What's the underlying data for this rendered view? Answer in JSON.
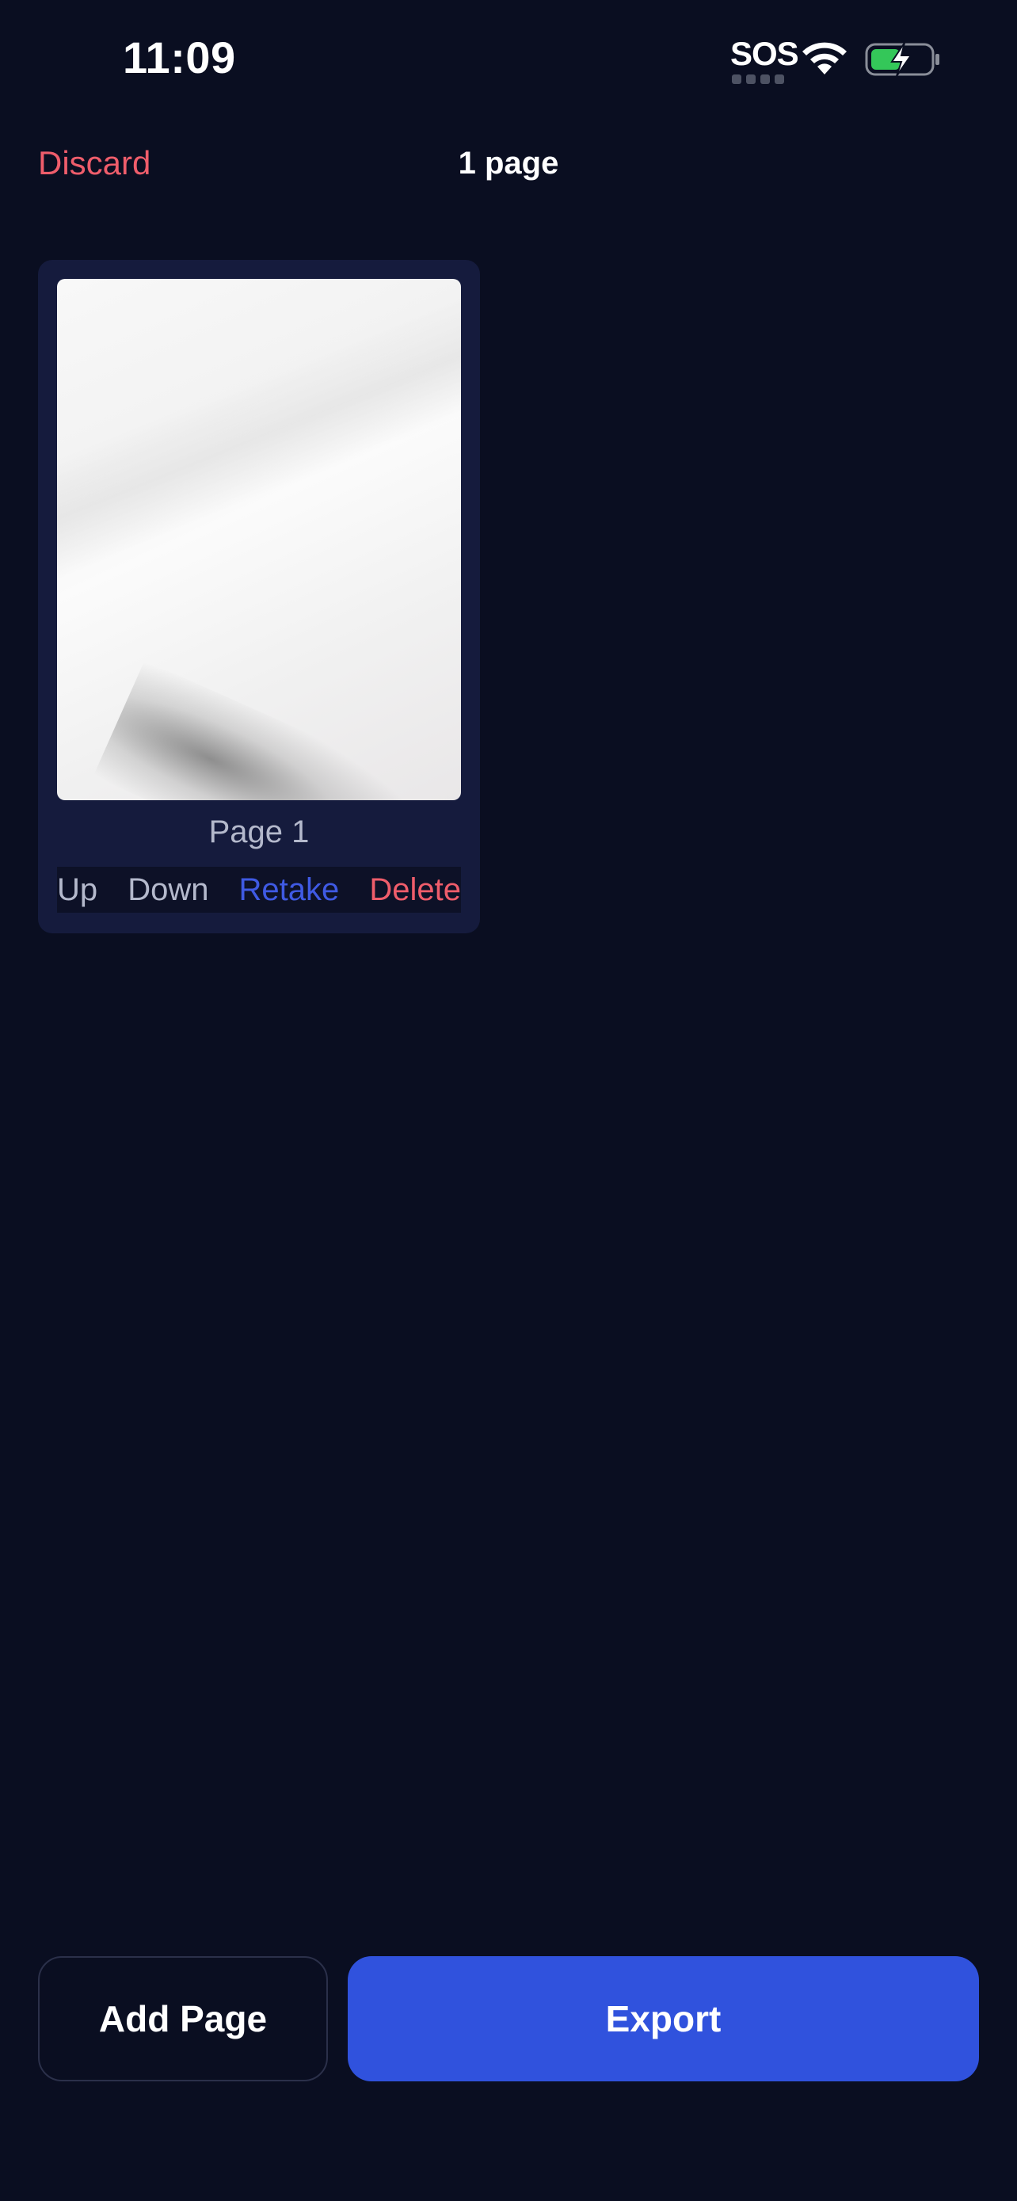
{
  "status_bar": {
    "time": "11:09",
    "sos": "SOS",
    "battery_color": "#34c759",
    "icons": [
      "wifi-icon",
      "battery-charging-icon"
    ]
  },
  "nav": {
    "discard_label": "Discard",
    "page_count": "1 page"
  },
  "pages": [
    {
      "label": "Page 1",
      "actions": {
        "up": "Up",
        "down": "Down",
        "retake": "Retake",
        "delete": "Delete"
      }
    }
  ],
  "footer": {
    "add_page_label": "Add Page",
    "export_label": "Export"
  },
  "colors": {
    "background": "#0a0e21",
    "card": "#151b3d",
    "accent_blue": "#3052dd",
    "danger_red": "#ef5d6b"
  }
}
